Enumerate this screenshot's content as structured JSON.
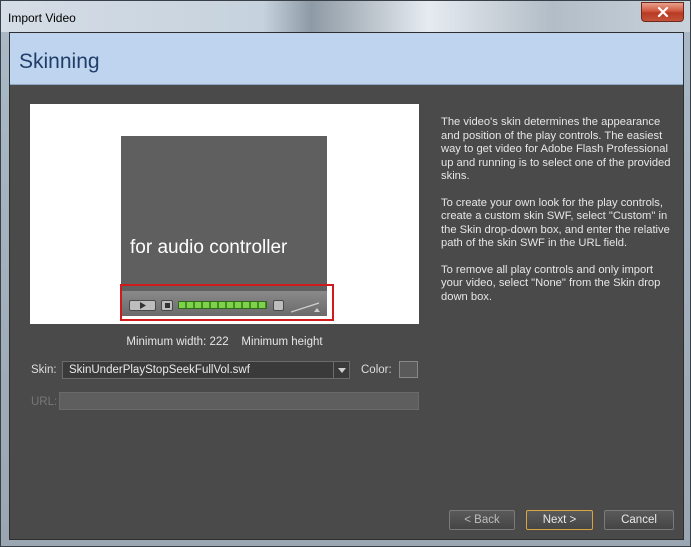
{
  "window": {
    "title": "Import Video"
  },
  "header": {
    "title": "Skinning"
  },
  "preview": {
    "player_text": "for audio controller",
    "min_size": "Minimum width: 222    Minimum height"
  },
  "form": {
    "skin_label": "Skin:",
    "skin_value": "SkinUnderPlayStopSeekFullVol.swf",
    "color_label": "Color:",
    "url_label": "URL:",
    "url_value": "",
    "swatch_color": "#5a5a5a"
  },
  "description": {
    "p1": "The video's skin determines the appearance and position of the play controls. The easiest way to get video for Adobe Flash Professional up and running is to select one of the provided skins.",
    "p2": "To create your own look for the play controls, create a custom skin SWF, select \"Custom\" in the Skin drop-down box, and enter the relative path of the skin SWF in the URL field.",
    "p3": "To remove all play controls and only import your video, select \"None\" from the Skin drop down box."
  },
  "buttons": {
    "back": "< Back",
    "next": "Next >",
    "cancel": "Cancel"
  },
  "colors": {
    "accent_next_border": "#d9a441",
    "highlight_red": "#d11a1a",
    "header_bg": "#bfd4ee",
    "seek_green": "#7fd14a"
  }
}
